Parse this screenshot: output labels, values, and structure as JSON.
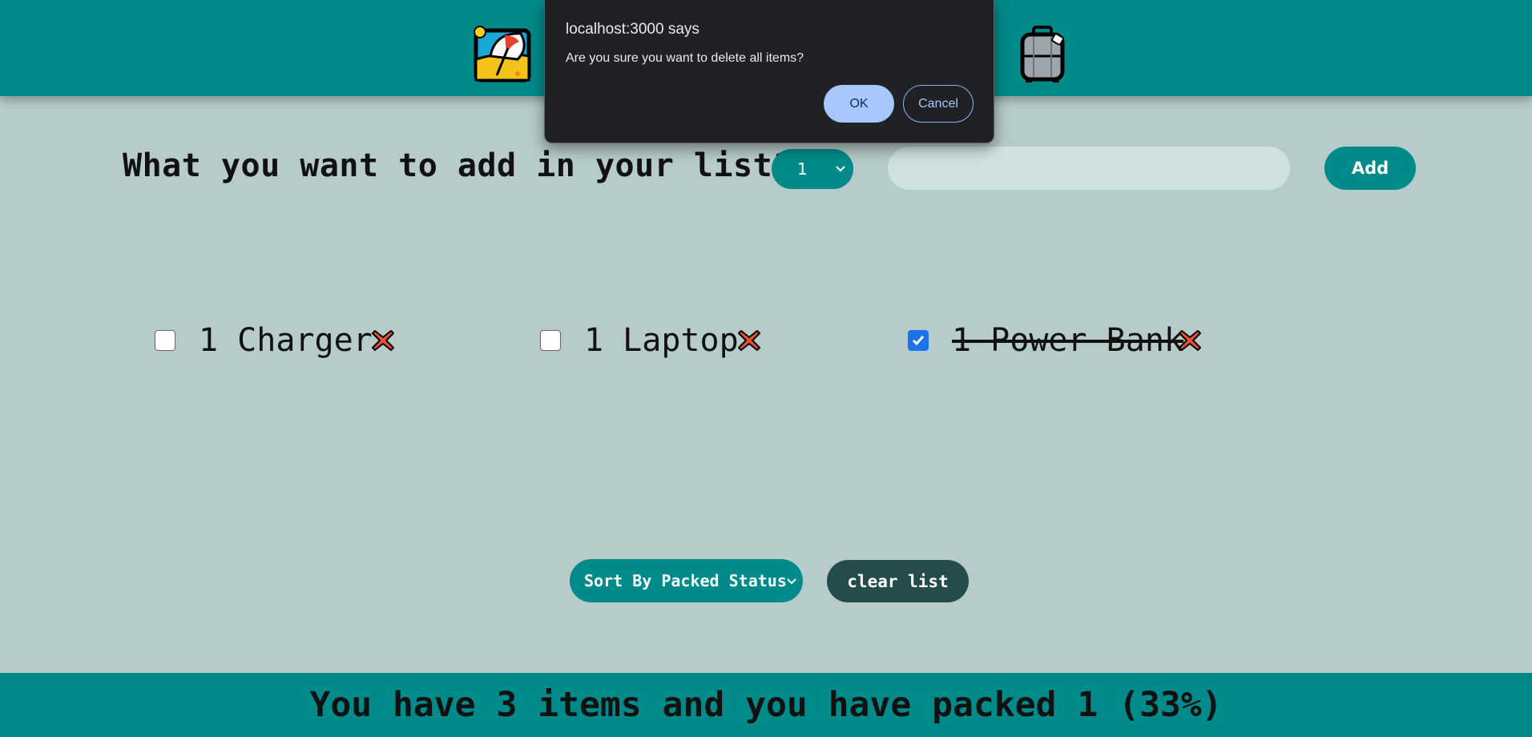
{
  "header": {
    "left_icon": "beach-umbrella-icon",
    "right_icon": "luggage-icon"
  },
  "form": {
    "title": "What you want to add in your list?",
    "quantity_value": "1",
    "item_placeholder": "",
    "add_label": "Add"
  },
  "items": [
    {
      "label": "1 Charger",
      "packed": false
    },
    {
      "label": "1 Laptop",
      "packed": false
    },
    {
      "label": "1 Power Bank",
      "packed": true
    }
  ],
  "actions": {
    "sort_label": "Sort By Packed Status",
    "clear_label": "clear list"
  },
  "stats": {
    "text": "You have 3 items and you have packed 1 (33%)"
  },
  "dialog": {
    "title": "localhost:3000 says",
    "message": "Are you sure you want to delete all items?",
    "ok_label": "OK",
    "cancel_label": "Cancel"
  },
  "colors": {
    "teal": "#018a8a",
    "background": "#b6cbca",
    "dark_button": "#254c4c",
    "delete": "#e5502f"
  }
}
